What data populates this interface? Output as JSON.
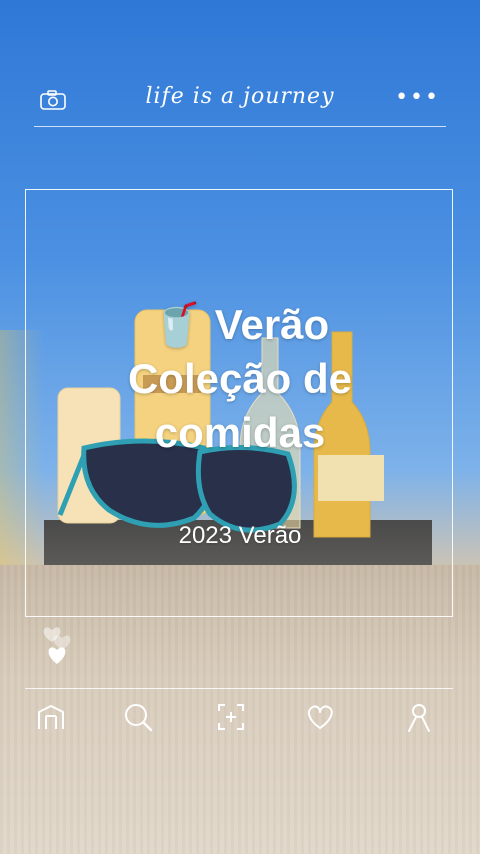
{
  "app": {
    "brand_text": "life is a journey"
  },
  "header": {
    "camera_icon": "camera-icon",
    "more_icon": "more-dots-icon",
    "more_label": "•••"
  },
  "post": {
    "emoji": "🥤",
    "title_line1": "Verão",
    "title_line2": "Coleção de",
    "title_line3": "comidas",
    "subtitle": "2023 Verão"
  },
  "reactions": {
    "icon": "heart-icon"
  },
  "nav": {
    "items": [
      {
        "icon": "home-icon"
      },
      {
        "icon": "search-icon"
      },
      {
        "icon": "add-post-icon"
      },
      {
        "icon": "likes-icon"
      },
      {
        "icon": "profile-icon"
      }
    ]
  },
  "colors": {
    "sky": "#4b90e2",
    "overlay_text": "#ffffff",
    "wall": "#d9cdbc"
  }
}
